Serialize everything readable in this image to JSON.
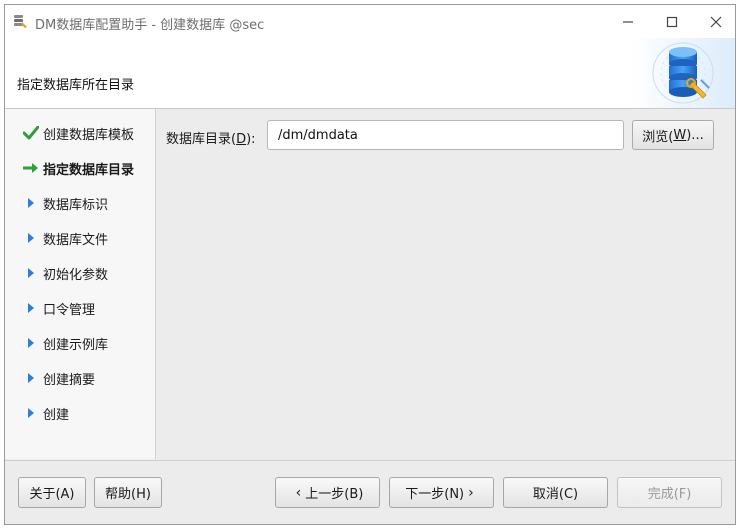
{
  "window": {
    "title": "DM数据库配置助手 - 创建数据库 @sec",
    "icon": "dm-database-app-icon",
    "controls": [
      "minimize-icon",
      "maximize-icon",
      "close-icon"
    ]
  },
  "header": {
    "title": "指定数据库所在目录",
    "graphic": "database-wrench-icon"
  },
  "steps": [
    {
      "label": "创建数据库模板",
      "state": "done",
      "icon": "checkmark-icon"
    },
    {
      "label": "指定数据库目录",
      "state": "current",
      "icon": "arrow-right-icon"
    },
    {
      "label": "数据库标识",
      "state": "pending",
      "icon": "triangle-right-icon"
    },
    {
      "label": "数据库文件",
      "state": "pending",
      "icon": "triangle-right-icon"
    },
    {
      "label": "初始化参数",
      "state": "pending",
      "icon": "triangle-right-icon"
    },
    {
      "label": "口令管理",
      "state": "pending",
      "icon": "triangle-right-icon"
    },
    {
      "label": "创建示例库",
      "state": "pending",
      "icon": "triangle-right-icon"
    },
    {
      "label": "创建摘要",
      "state": "pending",
      "icon": "triangle-right-icon"
    },
    {
      "label": "创建",
      "state": "pending",
      "icon": "triangle-right-icon"
    }
  ],
  "form": {
    "dir_label_prefix": "数据库目录(",
    "dir_label_mnemonic": "D",
    "dir_label_suffix": "):",
    "dir_value": "/dm/dmdata",
    "browse_prefix": "浏览(",
    "browse_mnemonic": "W",
    "browse_suffix": ")..."
  },
  "footer": {
    "about": "关于(A)",
    "help": "帮助(H)",
    "prev": "上一步(B)",
    "next": "下一步(N)",
    "cancel": "取消(C)",
    "finish": "完成(F)"
  },
  "colors": {
    "check": "#2e9e3a",
    "current_arrow": "#2e9e3a",
    "pending_triangle": "#2b7fd6",
    "disabled_text": "#9a9a9a"
  }
}
